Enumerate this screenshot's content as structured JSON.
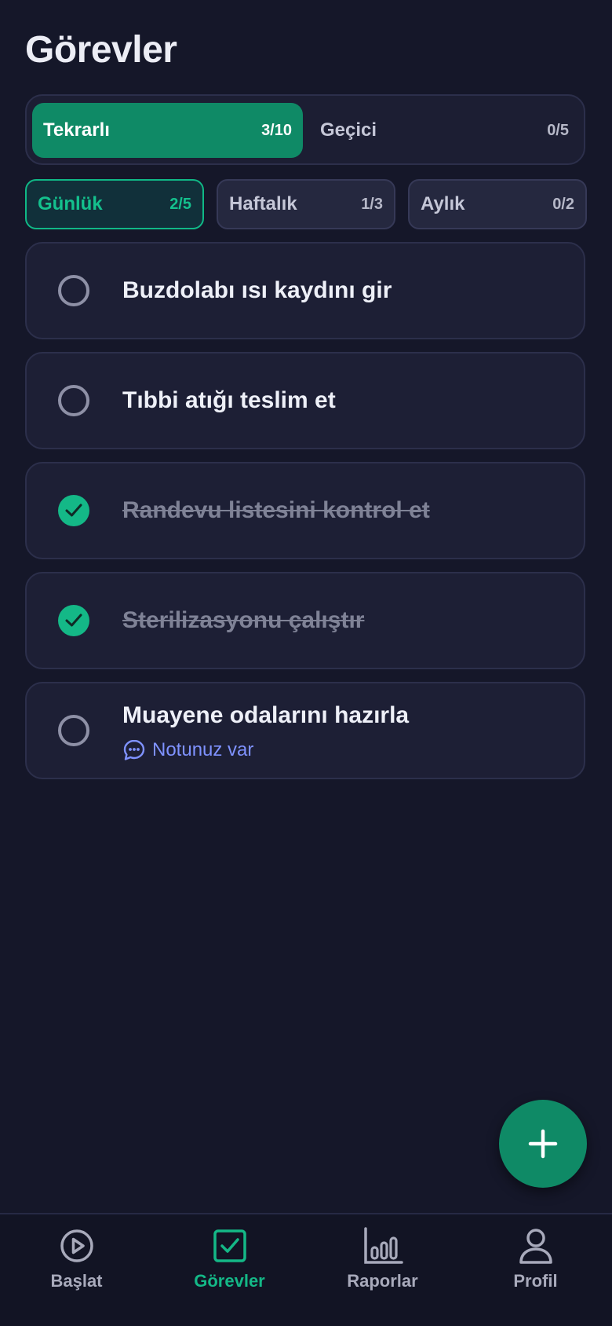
{
  "header": {
    "title": "Görevler"
  },
  "type_tabs": [
    {
      "label": "Tekrarlı",
      "count": "3/10",
      "active": true
    },
    {
      "label": "Geçici",
      "count": "0/5",
      "active": false
    }
  ],
  "frequency_tabs": [
    {
      "label": "Günlük",
      "count": "2/5",
      "active": true
    },
    {
      "label": "Haftalık",
      "count": "1/3",
      "active": false
    },
    {
      "label": "Aylık",
      "count": "0/2",
      "active": false
    }
  ],
  "tasks": [
    {
      "title": "Buzdolabı ısı kaydını gir",
      "done": false
    },
    {
      "title": "Tıbbi atığı teslim et",
      "done": false
    },
    {
      "title": "Randevu listesini kontrol et",
      "done": true
    },
    {
      "title": "Sterilizasyonu çalıştır",
      "done": true
    },
    {
      "title": "Muayene odalarını hazırla",
      "done": false,
      "note": "Notunuz var"
    }
  ],
  "fab": {
    "icon": "plus-icon"
  },
  "bottom_nav": [
    {
      "label": "Başlat",
      "icon": "play-circle-icon",
      "active": false
    },
    {
      "label": "Görevler",
      "icon": "checkbox-icon",
      "active": true
    },
    {
      "label": "Raporlar",
      "icon": "bar-chart-icon",
      "active": false
    },
    {
      "label": "Profil",
      "icon": "user-icon",
      "active": false
    }
  ],
  "colors": {
    "background": "#151729",
    "accent": "#0f8a66",
    "accent_bright": "#14b887",
    "note_link": "#7f92ff"
  }
}
